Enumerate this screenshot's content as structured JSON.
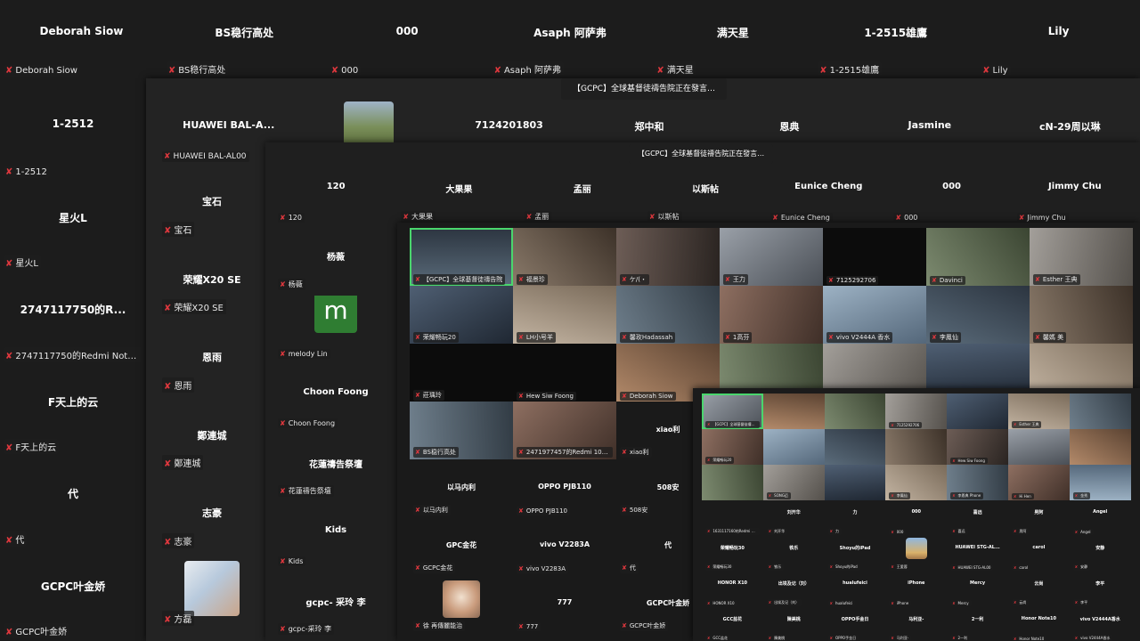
{
  "banner_text": "【GCPC】全球基督徒禱告院正在發言…",
  "layer1": {
    "tiles": [
      {
        "name": "Deborah Siow",
        "label": "Deborah Siow"
      },
      {
        "name": "BS稳行高处",
        "label": "BS稳行高处"
      },
      {
        "name": "000",
        "label": "000"
      },
      {
        "name": "Asaph 阿萨弗",
        "label": "Asaph 阿萨弗"
      },
      {
        "name": "满天星",
        "label": "满天星"
      },
      {
        "name": "1-2515雄鷹",
        "label": "1-2515雄鷹"
      },
      {
        "name": "Lily",
        "label": "Lily"
      }
    ],
    "left_column": [
      {
        "name": "1-2512",
        "label": "1-2512"
      },
      {
        "name": "星火L",
        "label": "星火L"
      },
      {
        "name": "2747117750的R...",
        "label": "2747117750的Redmi Note 1"
      },
      {
        "name": "F天上的云",
        "label": "F天上的云"
      },
      {
        "name": "代",
        "label": "代"
      },
      {
        "name": "GCPC叶金娇",
        "label": "GCPC叶金娇"
      }
    ]
  },
  "layer2": {
    "top_row": [
      {
        "name": "HUAWEI BAL-A...",
        "label": "HUAWEI BAL-AL00"
      },
      {
        "name": "",
        "label": "",
        "photo": true
      },
      {
        "name": "7124201803",
        "label": ""
      },
      {
        "name": "郑中和",
        "label": ""
      },
      {
        "name": "恩典",
        "label": ""
      },
      {
        "name": "Jasmine",
        "label": ""
      },
      {
        "name": "cN-29周以琳",
        "label": ""
      }
    ],
    "left_column": [
      {
        "name": "宝石",
        "label": "宝石"
      },
      {
        "name": "荣耀X20 SE",
        "label": "荣耀X20 SE"
      },
      {
        "name": "恩雨",
        "label": "恩雨"
      },
      {
        "name": "鄭連城",
        "label": "鄭連城"
      },
      {
        "name": "志豪",
        "label": "志豪"
      },
      {
        "name": "",
        "label": "方磊",
        "photo": true
      }
    ]
  },
  "layer3": {
    "top_row": [
      {
        "name": "120",
        "label": "120"
      },
      {
        "name": "大果果",
        "label": "大果果"
      },
      {
        "name": "孟丽",
        "label": "孟丽"
      },
      {
        "name": "以斯帖",
        "label": "以斯帖"
      },
      {
        "name": "Eunice Cheng",
        "label": "Eunice Cheng"
      },
      {
        "name": "000",
        "label": "000"
      },
      {
        "name": "Jimmy Chu",
        "label": "Jimmy Chu"
      }
    ],
    "left_column": [
      {
        "name": "杨薇",
        "label": "杨薇"
      },
      {
        "name": "",
        "label": "melody Lin",
        "avatar_letter": "m"
      },
      {
        "name": "Choon Foong",
        "label": "Choon Foong"
      },
      {
        "name": "花蓮禱告祭壇",
        "label": "花蓮禱告祭壇"
      },
      {
        "name": "Kids",
        "label": "Kids"
      },
      {
        "name": "gcpc- 采玲 李",
        "label": "gcpc-采玲 李"
      }
    ]
  },
  "layer4": {
    "rows": [
      [
        {
          "label": "【GCPC】全球基督徒禱告院",
          "video": true
        },
        {
          "label": "福景珍",
          "video": true
        },
        {
          "label": "ケ/(・",
          "video": true
        },
        {
          "label": "王力",
          "video": true
        },
        {
          "label": "7125292706",
          "video": true
        },
        {
          "label": "Davinci",
          "video": true
        },
        {
          "label": "Esther 王典",
          "video": true
        }
      ],
      [
        {
          "label": "荣耀畅玩20",
          "video": true
        },
        {
          "label": "LH小号羊",
          "video": true
        },
        {
          "label": "馨玫Hadassah",
          "video": true
        },
        {
          "label": "1高芬",
          "video": true
        },
        {
          "label": "vivo V2444A 香水",
          "video": true
        },
        {
          "label": "李鳳仙",
          "video": true
        },
        {
          "label": "馨媽 美",
          "video": true
        }
      ],
      [
        {
          "label": "莊瑀玲",
          "video": true
        },
        {
          "label": "Hew Siw Foong",
          "video": true
        },
        {
          "label": "Deborah Siow",
          "video": true
        },
        {
          "label": "",
          "video": true
        },
        {
          "label": "",
          "video": true
        },
        {
          "label": "",
          "video": true
        },
        {
          "label": "",
          "video": true
        }
      ],
      [
        {
          "label": "BS稳行高处",
          "video": true
        },
        {
          "label": "2471977457的Redmi 10X 4G",
          "video": true
        },
        {
          "name": "xiao利",
          "label": "xiao利"
        }
      ],
      [
        {
          "name": "以马内利",
          "label": "以马内利"
        },
        {
          "name": "OPPO PJB110",
          "label": "OPPO PJB110"
        },
        {
          "name": "508安",
          "label": "508安"
        }
      ],
      [
        {
          "name": "GPC金花",
          "label": "GCPC金花"
        },
        {
          "name": "vivo V2283A",
          "label": "vivo V2283A"
        },
        {
          "name": "代",
          "label": "代"
        }
      ],
      [
        {
          "name": "",
          "label": "徐 再傳麗能治",
          "photo": true
        },
        {
          "name": "777",
          "label": "777"
        },
        {
          "name": "GCPC叶金娇",
          "label": "GCPC叶金娇"
        }
      ]
    ]
  },
  "layer5": {
    "rows": [
      [
        {
          "label": "【GCPC】全球基督徒禱告院",
          "video": true
        },
        {
          "label": "",
          "video": true
        },
        {
          "label": "",
          "video": true
        },
        {
          "label": "7125292706",
          "video": true
        },
        {
          "label": "",
          "video": true
        },
        {
          "label": "Esther 王典",
          "video": true
        },
        {
          "label": "",
          "video": true
        }
      ],
      [
        {
          "label": "荣耀畅玩20",
          "video": true
        },
        {
          "label": "",
          "video": true
        },
        {
          "label": "",
          "video": true
        },
        {
          "label": "",
          "video": true
        },
        {
          "label": "Hew Siw Foong",
          "video": true
        },
        {
          "label": "",
          "video": true
        },
        {
          "label": "",
          "video": true
        }
      ],
      [
        {
          "label": "",
          "video": true
        },
        {
          "label": "SONG迈",
          "video": true
        },
        {
          "label": "",
          "video": true
        },
        {
          "label": "李鳳仙",
          "video": true
        },
        {
          "label": "李恩典 Phone",
          "video": true
        },
        {
          "label": "Hi Hen",
          "video": true
        },
        {
          "label": "金秀",
          "video": true
        }
      ],
      [
        {
          "name": "",
          "label": "1631117160的Redmi A3 Pro"
        },
        {
          "name": "刘开华",
          "label": "刘开华"
        },
        {
          "name": "力",
          "label": "力"
        },
        {
          "name": "000",
          "label": "000"
        },
        {
          "name": "喜远",
          "label": "喜远"
        },
        {
          "name": "男阿",
          "label": "男阿"
        },
        {
          "name": "Angel",
          "label": "Angel"
        }
      ],
      [
        {
          "name": "荣耀畅玩30",
          "label": "荣耀畅玩30"
        },
        {
          "name": "铁乐",
          "label": "铁乐"
        },
        {
          "name": "Shoyu的iPad",
          "label": "Shoyu的iPad"
        },
        {
          "name": "",
          "label": "王愛蓉",
          "photo": true
        },
        {
          "name": "HUAWEI STG-AL...",
          "label": "HUAWEI STG-AL00"
        },
        {
          "name": "carol",
          "label": "carol"
        },
        {
          "name": "安静",
          "label": "安静"
        }
      ],
      [
        {
          "name": "HONOR X10",
          "label": "HONOR X10"
        },
        {
          "name": "出埃及记（刘）",
          "label": "出埃及记（刘）"
        },
        {
          "name": "hualufeici",
          "label": "hualufeici"
        },
        {
          "name": "iPhone",
          "label": "iPhone"
        },
        {
          "name": "Mercy",
          "label": "Mercy"
        },
        {
          "name": "云尚",
          "label": "云尚"
        },
        {
          "name": "李平",
          "label": "李平"
        }
      ],
      [
        {
          "name": "GCC盐花",
          "label": "GCC盐花"
        },
        {
          "name": "陳美桃",
          "label": "陳美桃"
        },
        {
          "name": "OPPO手金日",
          "label": "OPPO手金日"
        },
        {
          "name": "马利亚-",
          "label": "马利亚-"
        },
        {
          "name": "2一利",
          "label": "2一利"
        },
        {
          "name": "Honor Note10",
          "label": "Honor Note10"
        },
        {
          "name": "vivo V2444A香水",
          "label": "vivo V2444A香水"
        }
      ]
    ]
  },
  "colors": {
    "background": "#1c1c1c",
    "mute_icon": "#e0383e",
    "active_speaker": "#4ad66d",
    "avatar_m": "#2f7d32"
  }
}
